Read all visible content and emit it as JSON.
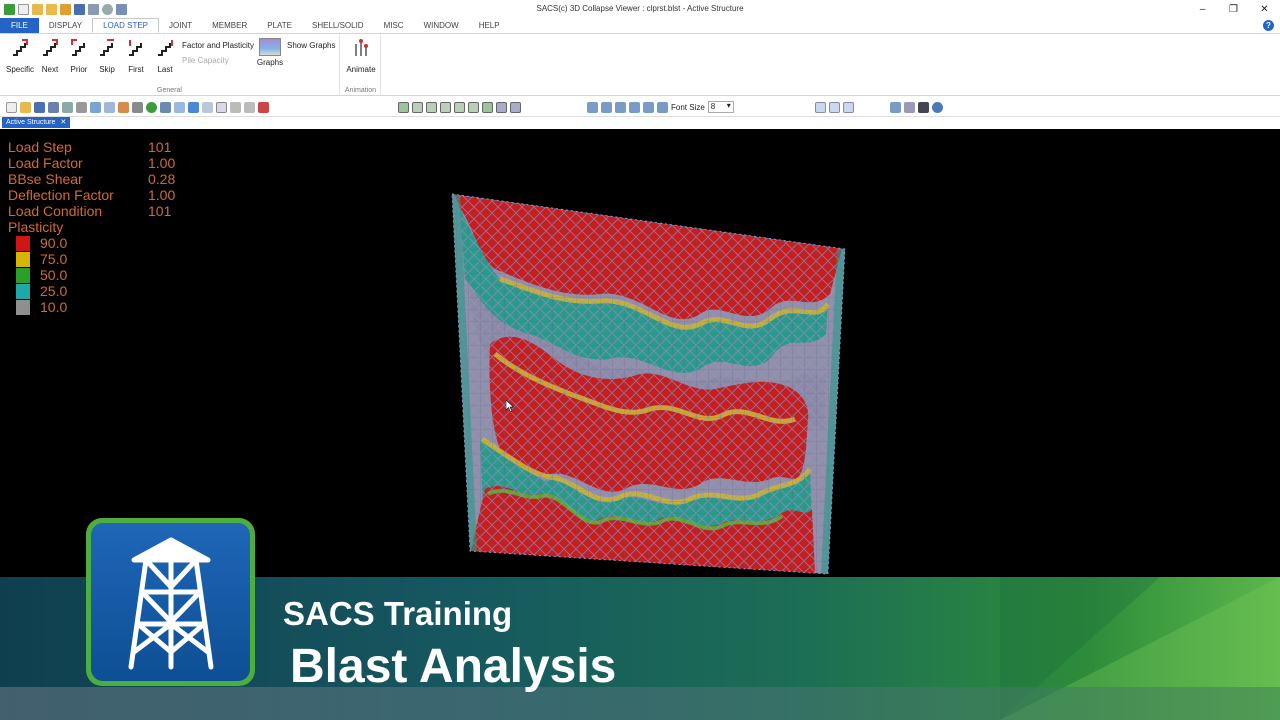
{
  "window": {
    "title": "SACS(c) 3D Collapse Viewer : clprst.blst - Active Structure",
    "controls": [
      "–",
      "❐",
      "✕"
    ]
  },
  "tabs": [
    "FILE",
    "DISPLAY",
    "LOAD STEP",
    "JOINT",
    "MEMBER",
    "PLATE",
    "SHELL/SOLID",
    "MISC",
    "WINDOW",
    "HELP"
  ],
  "active_tab": "LOAD STEP",
  "help_label": "?",
  "ribbon": {
    "buttons": [
      "Specific",
      "Next",
      "Prior",
      "Skip",
      "First",
      "Last"
    ],
    "factor_plasticity": "Factor and Plasticity",
    "pile_capacity": "Pile Capacity",
    "show_graphs": "Show Graphs",
    "graphs": "Graphs",
    "general_label": "General",
    "animate": "Animate",
    "animation_label": "Animation"
  },
  "toolbar": {
    "font_size_label": "Font Size",
    "font_size_value": "8"
  },
  "document_tab": {
    "label": "Active Structure",
    "close": "✕"
  },
  "info": {
    "load_step_label": "Load Step",
    "load_step_value": "101",
    "load_factor_label": "Load Factor",
    "load_factor_value": "1.00",
    "base_shear_label": "BBse Shear",
    "base_shear_value": "0.28",
    "deflection_label": "Deflection Factor",
    "deflection_value": "1.00",
    "load_condition_label": "Load Condition",
    "load_condition_value": "101",
    "plasticity_label": "Plasticity"
  },
  "legend": [
    {
      "value": "90.0",
      "color": "#d01515"
    },
    {
      "value": "75.0",
      "color": "#d6b400"
    },
    {
      "value": "50.0",
      "color": "#2aa02a"
    },
    {
      "value": "25.0",
      "color": "#20a8a8"
    },
    {
      "value": "10.0",
      "color": "#8f8f8f"
    }
  ],
  "banner": {
    "subtitle": "SACS Training",
    "title": "Blast Analysis"
  }
}
